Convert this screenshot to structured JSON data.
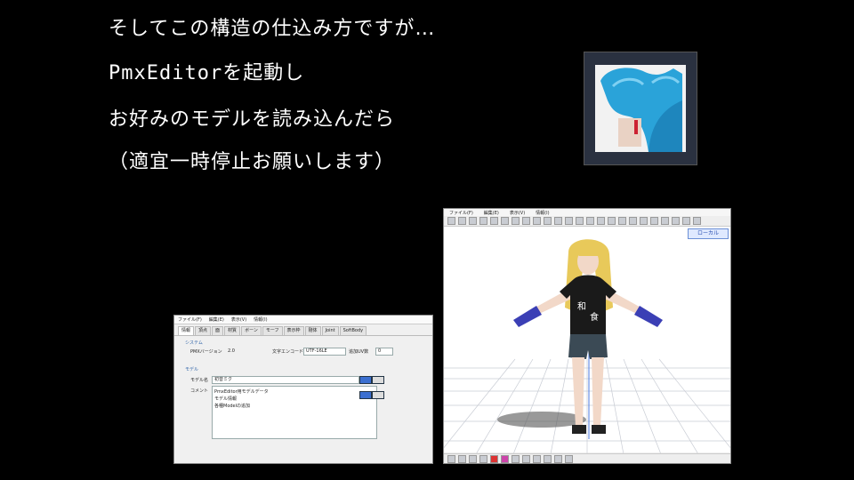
{
  "slide": {
    "lines": [
      "そしてこの構造の仕込み方ですが…",
      "PmxEditorを起動し",
      "お好みのモデルを読み込んだら",
      "（適宜一時停止お願いします）"
    ]
  },
  "colors": {
    "background": "#000000",
    "text": "#ffffff",
    "hair": "#2aa3d9",
    "shirt": "#1a1a1a",
    "gloves": "#3b3fb5"
  },
  "thumbnail": {
    "icon": "hair-closeup-image"
  },
  "editor": {
    "menu": [
      "ファイル(F)",
      "編集(E)",
      "表示(V)",
      "情報(I)"
    ],
    "tabs": [
      "情報",
      "頂点",
      "面",
      "材質",
      "ボーン",
      "モーフ",
      "表示枠",
      "剛体",
      "Joint",
      "SoftBody"
    ],
    "fields": {
      "version_label": "PMXバージョン",
      "version_value": "2.0",
      "encoding_label": "文字エンコード",
      "encoding_value": "UTF-16LE",
      "uv_label": "追加UV数",
      "uv_value": "0",
      "group_system": "システム",
      "group_model": "モデル",
      "model_name_label": "モデル名",
      "model_name_value": "初音ミク",
      "comment_label": "コメント"
    },
    "comment_lines": [
      "PmxEditor用モデルデータ",
      "モデル情報",
      "各種Modelの追加"
    ]
  },
  "viewer": {
    "menu": [
      "ファイル(F)",
      "編集(E)",
      "表示(V)",
      "情報(I)"
    ],
    "axis_badge": "ローカル"
  }
}
